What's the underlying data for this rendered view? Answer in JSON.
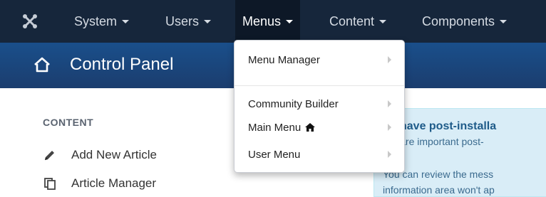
{
  "navbar": {
    "logo_icon": "joomla-logo-icon",
    "items": [
      {
        "label": "System"
      },
      {
        "label": "Users"
      },
      {
        "label": "Menus"
      },
      {
        "label": "Content"
      },
      {
        "label": "Components"
      }
    ]
  },
  "header": {
    "icon": "home-icon",
    "title": "Control Panel"
  },
  "sidebar": {
    "section_title": "CONTENT",
    "links": [
      {
        "label": "Add New Article",
        "icon": "pencil-icon"
      },
      {
        "label": "Article Manager",
        "icon": "copy-icon"
      }
    ]
  },
  "alert": {
    "title": "ou have post-installa",
    "line1": "ere are important post-",
    "line2": "You can review the mess",
    "line3": "information area won't ap"
  },
  "menus_dropdown": {
    "items": [
      {
        "label": "Menu Manager"
      },
      {
        "label": "Community Builder"
      },
      {
        "label": "Main Menu"
      },
      {
        "label": "User Menu"
      }
    ]
  },
  "colors": {
    "navbar_bg": "#16263b",
    "header_bg": "#1b4478",
    "alert_bg": "#d9edf7",
    "alert_title": "#1e5b89"
  }
}
